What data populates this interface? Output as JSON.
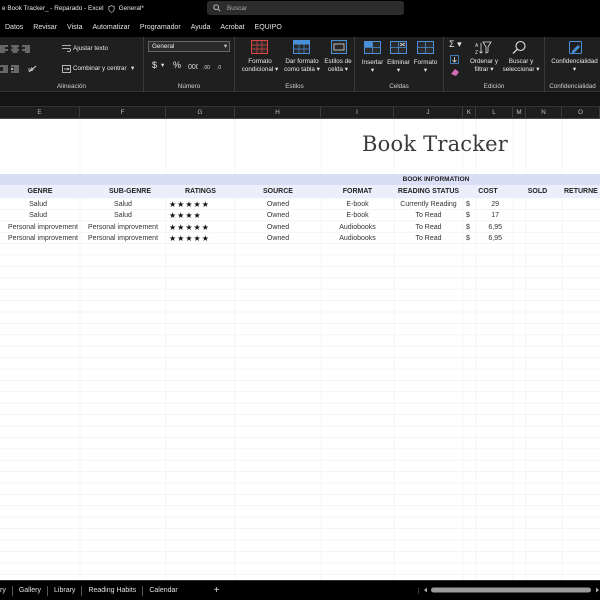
{
  "window": {
    "title": "e Book Tracker_  -  Reparado  -  Excel",
    "sensitivity": "General*",
    "search_placeholder": "Buscar"
  },
  "menu": [
    "Datos",
    "Revisar",
    "Vista",
    "Automatizar",
    "Programador",
    "Ayuda",
    "Acrobat",
    "EQUIPO"
  ],
  "ribbon": {
    "wrap_text": "Ajustar texto",
    "merge_center": "Combinar y centrar",
    "alignment_label": "Alineación",
    "number_format": "General",
    "currency_symbol": "$",
    "percent_symbol": "%",
    "number_label": "Número",
    "conditional_format_l1": "Formato",
    "conditional_format_l2": "condicional",
    "format_table_l1": "Dar formato",
    "format_table_l2": "como tabla",
    "cell_styles_l1": "Estilos de",
    "cell_styles_l2": "celda",
    "styles_label": "Estilos",
    "insert": "Insertar",
    "delete": "Eliminar",
    "format": "Formato",
    "cells_label": "Celdas",
    "sort_filter_l1": "Ordenar y",
    "sort_filter_l2": "filtrar",
    "find_select_l1": "Buscar y",
    "find_select_l2": "seleccionar",
    "editing_label": "Edición",
    "confidentiality": "Confidencialidad",
    "confidentiality_label": "Confidencialidad"
  },
  "columns": [
    "E",
    "F",
    "G",
    "H",
    "I",
    "J",
    "K",
    "L",
    "M",
    "N",
    "O"
  ],
  "sheet": {
    "title": "Book Tracker",
    "section": "BOOK INFORMATION",
    "headers": {
      "genre": "GENRE",
      "subgenre": "SUB-GENRE",
      "ratings": "RATINGS",
      "source": "SOURCE",
      "format": "FORMAT",
      "reading_status": "READING STATUS",
      "cost": "COST",
      "sold": "SOLD",
      "returned": "RETURNE"
    },
    "rows": [
      {
        "genre": "Salud",
        "subgenre": "Salud",
        "stars": "★★★★★",
        "source": "Owned",
        "format": "E-book",
        "status": "Currently Reading",
        "currency": "$",
        "cost": "29"
      },
      {
        "genre": "Salud",
        "subgenre": "Salud",
        "stars": "★★★★",
        "source": "Owned",
        "format": "E-book",
        "status": "To Read",
        "currency": "$",
        "cost": "17"
      },
      {
        "genre": "Personal improvement",
        "subgenre": "Personal improvement",
        "stars": "★★★★★",
        "source": "Owned",
        "format": "Audiobooks",
        "status": "To Read",
        "currency": "$",
        "cost": "6,95"
      },
      {
        "genre": "Personal improvement",
        "subgenre": "Personal improvement",
        "stars": "★★★★★",
        "source": "Owned",
        "format": "Audiobooks",
        "status": "To Read",
        "currency": "$",
        "cost": "6,95"
      }
    ]
  },
  "tabs": [
    "ry",
    "Gallery",
    "Library",
    "Reading Habits",
    "Calendar"
  ],
  "tab_add": "+",
  "colors": {
    "band": "#d9def7",
    "header_row": "#eceffb",
    "accent_icon": "#4a90d9",
    "ribbon_bg": "#1f1f1f"
  }
}
